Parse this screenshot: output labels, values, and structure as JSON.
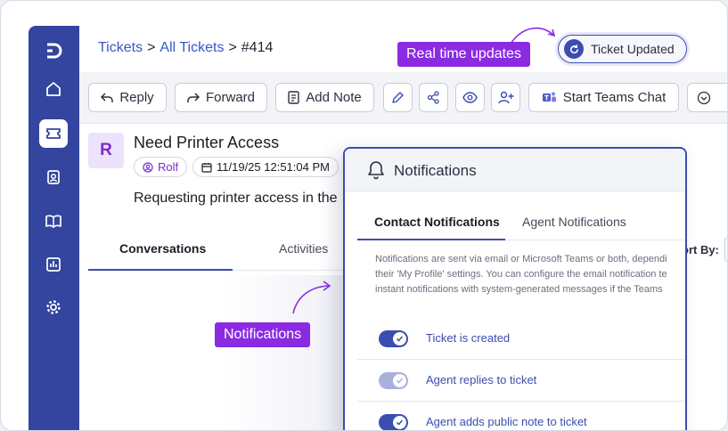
{
  "breadcrumb": {
    "tickets": "Tickets",
    "all_tickets": "All Tickets",
    "ticket_no": "#414",
    "separator": ">"
  },
  "callouts": {
    "realtime": "Real time updates",
    "notifications": "Notifications"
  },
  "status": {
    "ticket_updated": "Ticket Updated"
  },
  "toolbar": {
    "reply": "Reply",
    "forward": "Forward",
    "add_note": "Add Note",
    "teams_chat": "Start Teams Chat",
    "icons": [
      "pencil-icon",
      "share-icon",
      "eye-icon",
      "add-user-icon",
      "teams-icon",
      "chevron-down-icon"
    ]
  },
  "ticket": {
    "avatar_letter": "R",
    "subject": "Need Printer Access",
    "requester": "Rolf",
    "datetime": "11/19/25 12:51:04 PM",
    "description": "Requesting printer access in the"
  },
  "tabs": {
    "conversations": "Conversations",
    "activities": "Activities"
  },
  "sort": {
    "label": "ort By:"
  },
  "notifications": {
    "title": "Notifications",
    "tabs": {
      "contact": "Contact Notifications",
      "agent": "Agent Notifications"
    },
    "description": [
      "Notifications are sent via email or Microsoft Teams or both, dependi",
      "their 'My Profile' settings. You can configure the email notification te",
      "instant notifications with system-generated messages if the Teams"
    ],
    "items": [
      {
        "label": "Ticket is created",
        "enabled": true
      },
      {
        "label": "Agent replies to ticket",
        "enabled": true
      },
      {
        "label": "Agent adds public note to ticket",
        "enabled": true
      }
    ]
  },
  "colors": {
    "primary": "#3a4db0",
    "sidebar": "#33459e",
    "accent_purple": "#8a2be2",
    "avatar_bg": "#ece2fb"
  }
}
